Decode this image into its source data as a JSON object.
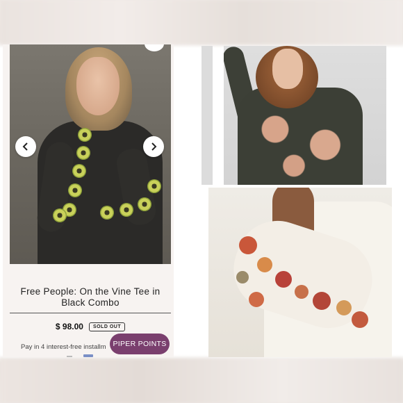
{
  "product": {
    "title": "Free People: On the Vine Tee in Black Combo",
    "price": "$ 98.00",
    "sold_badge": "SOLD OUT",
    "installments_text": "Pay in 4 interest-free installm",
    "points_button": "PIPER POINTS"
  },
  "gallery": {
    "prev_icon": "chevron-left-icon",
    "next_icon": "chevron-right-icon"
  },
  "colors": {
    "accent": "#7a3f6e",
    "badge_border": "#333333"
  }
}
